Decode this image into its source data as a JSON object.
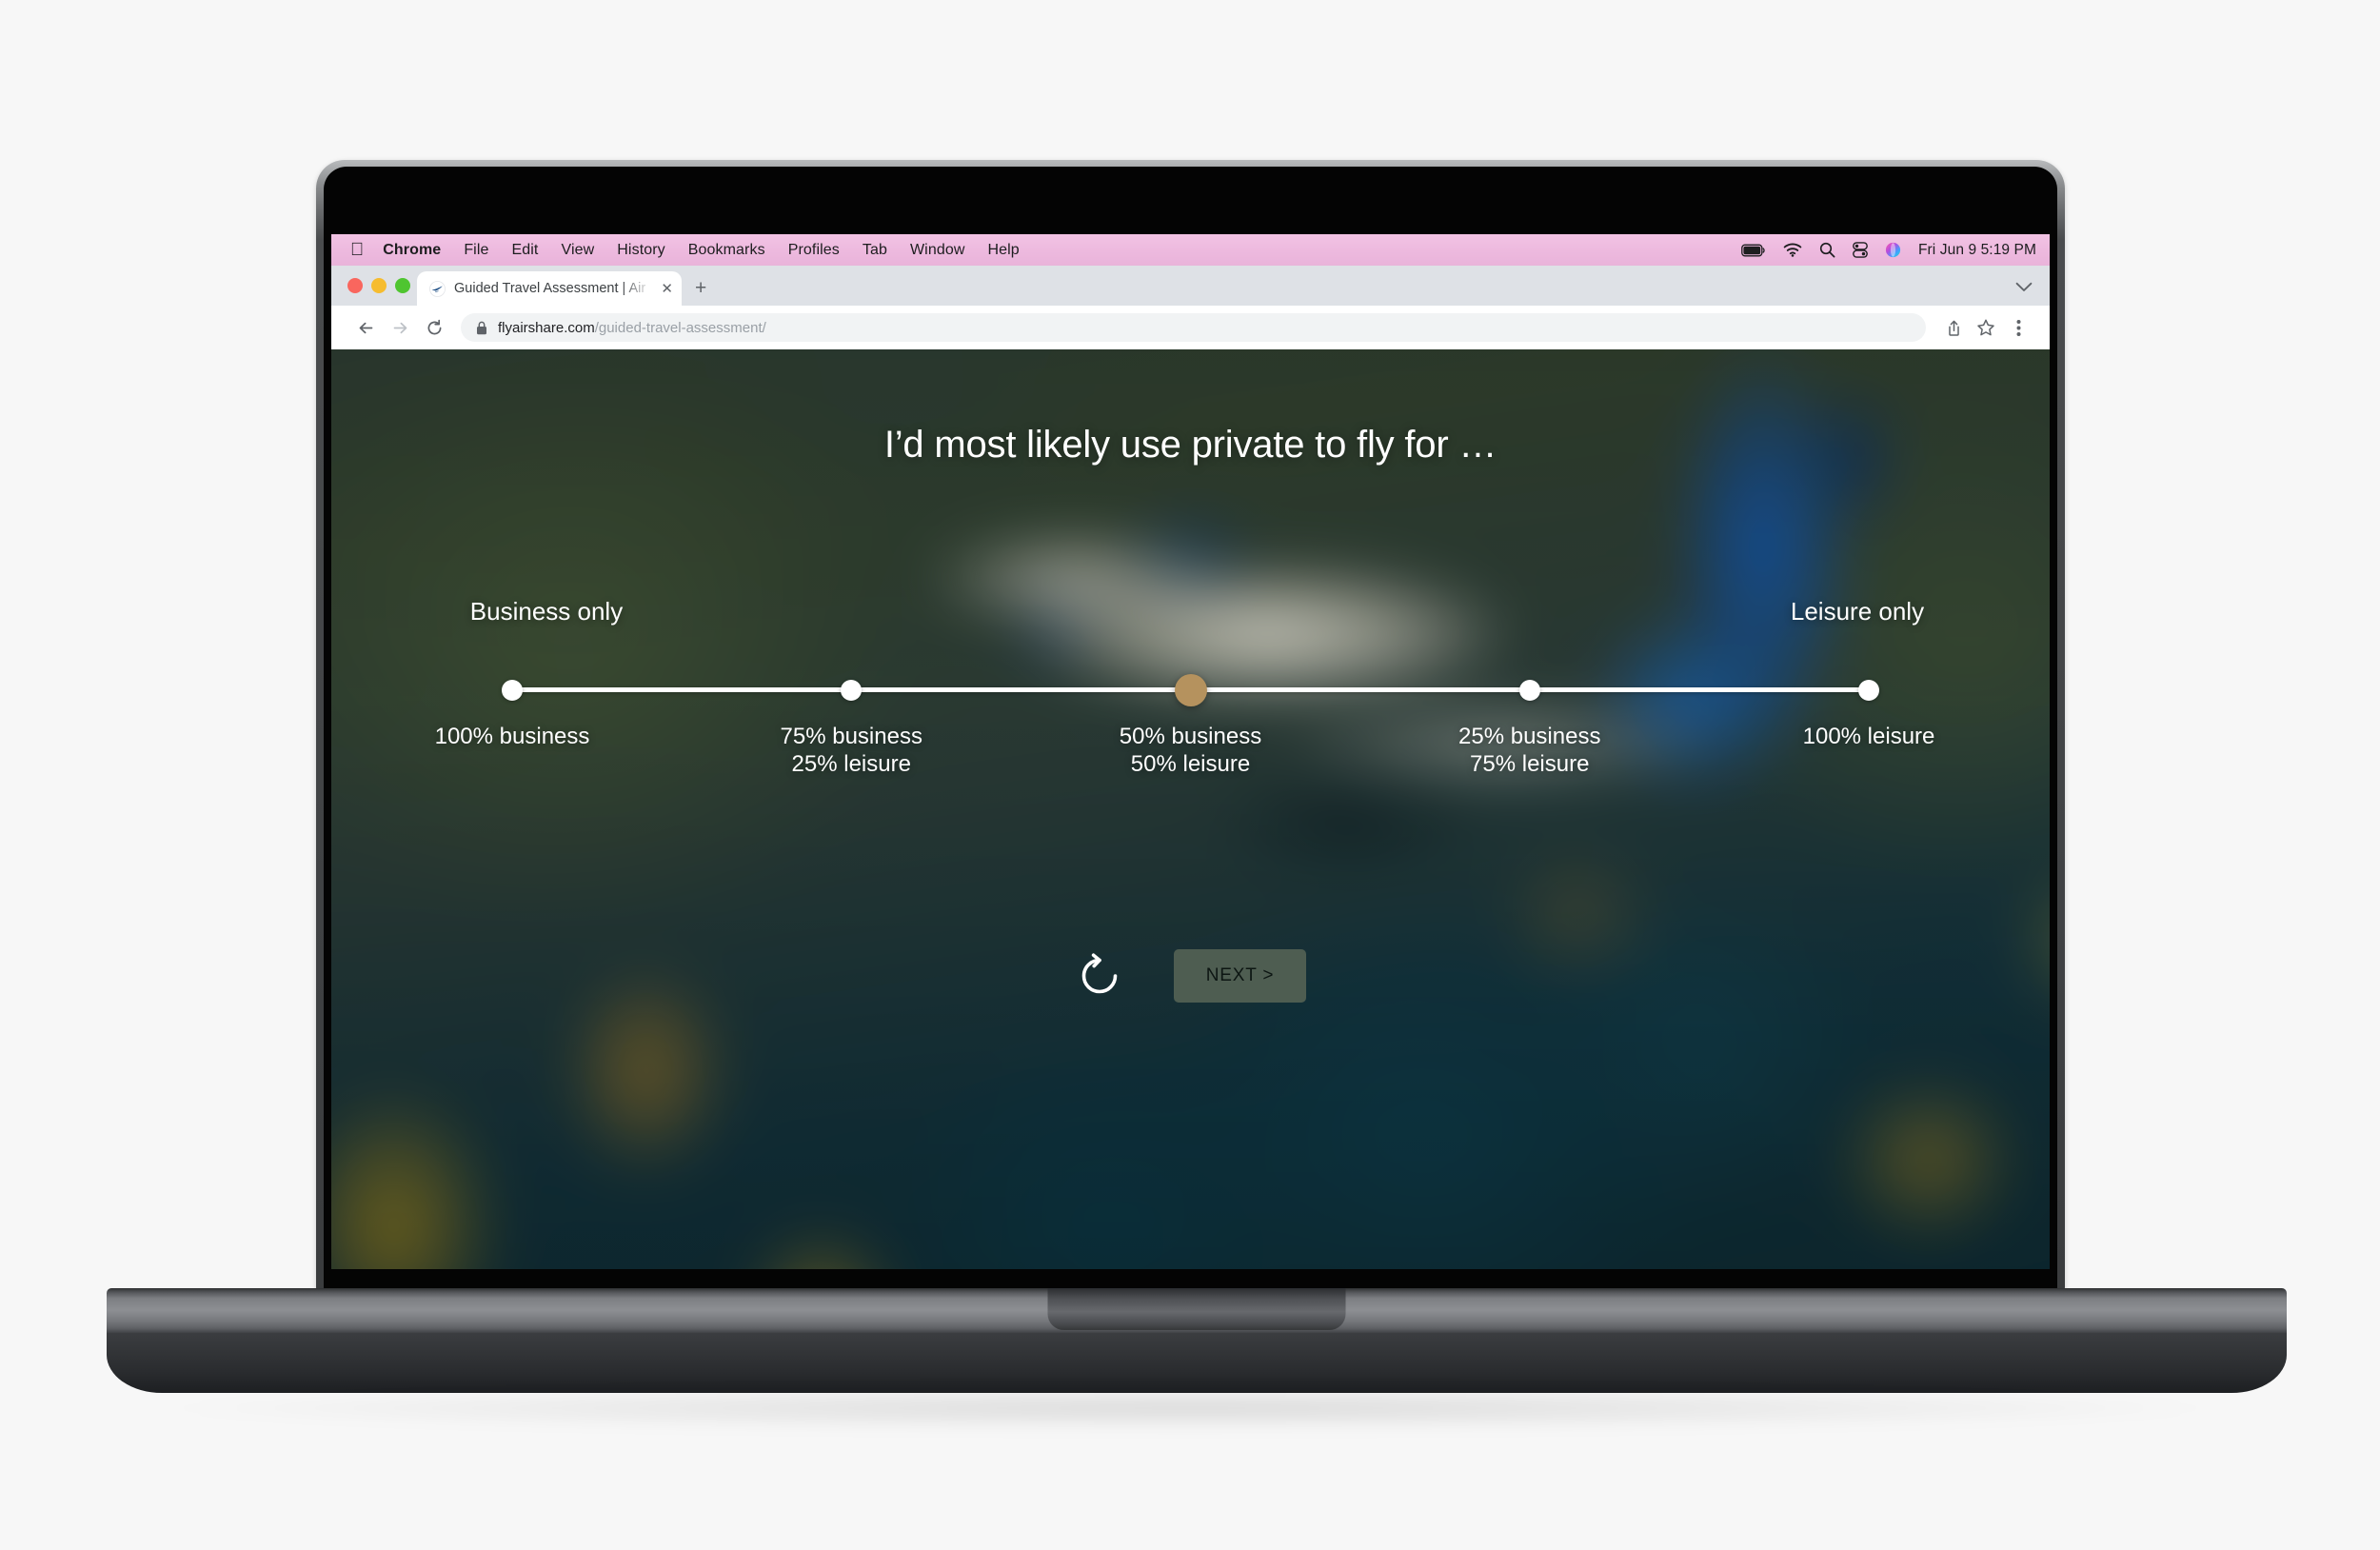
{
  "menubar": {
    "apple_glyph": "",
    "items": [
      {
        "label": "Chrome",
        "bold": true
      },
      {
        "label": "File",
        "bold": false
      },
      {
        "label": "Edit",
        "bold": false
      },
      {
        "label": "View",
        "bold": false
      },
      {
        "label": "History",
        "bold": false
      },
      {
        "label": "Bookmarks",
        "bold": false
      },
      {
        "label": "Profiles",
        "bold": false
      },
      {
        "label": "Tab",
        "bold": false
      },
      {
        "label": "Window",
        "bold": false
      },
      {
        "label": "Help",
        "bold": false
      }
    ],
    "status_icons": [
      "battery-icon",
      "wifi-icon",
      "spotlight-search-icon",
      "control-center-icon",
      "siri-icon"
    ],
    "clock": "Fri Jun 9  5:19 PM",
    "background_color": "#edb9de"
  },
  "browser": {
    "window_controls": [
      "close",
      "minimize",
      "zoom"
    ],
    "tab": {
      "favicon": "airshare-jet-icon",
      "title": "Guided Travel Assessment | Air",
      "close_glyph": "✕"
    },
    "new_tab_glyph": "+",
    "tab_list_icon": "chevron-down-icon",
    "toolbar": {
      "back_icon": "back-arrow-icon",
      "forward_icon": "forward-arrow-icon",
      "reload_icon": "reload-icon",
      "lock_icon": "lock-icon",
      "url_domain": "flyairshare.com",
      "url_path": "/guided-travel-assessment/",
      "share_icon": "share-icon",
      "bookmark_icon": "star-icon",
      "menu_icon": "three-dot-menu-icon"
    }
  },
  "page": {
    "headline": "I’d most likely use private to fly for …",
    "left_end_label": "Business\nonly",
    "right_end_label": "Leisure\nonly",
    "slider": {
      "selected_index": 2,
      "selected_color": "#b5925e",
      "stop_color": "#ffffff",
      "stops": [
        {
          "label": "100% business",
          "business_pct": 100,
          "leisure_pct": 0,
          "position_pct": 0
        },
        {
          "label": "75% business\n25% leisure",
          "business_pct": 75,
          "leisure_pct": 25,
          "position_pct": 25
        },
        {
          "label": "50% business\n50% leisure",
          "business_pct": 50,
          "leisure_pct": 50,
          "position_pct": 50
        },
        {
          "label": "25% business\n75% leisure",
          "business_pct": 25,
          "leisure_pct": 75,
          "position_pct": 75
        },
        {
          "label": "100% leisure",
          "business_pct": 0,
          "leisure_pct": 100,
          "position_pct": 100
        }
      ]
    },
    "reset_icon": "reset-circular-arrow-icon",
    "next_label": "NEXT >",
    "next_button_color": "#4e5d51"
  }
}
